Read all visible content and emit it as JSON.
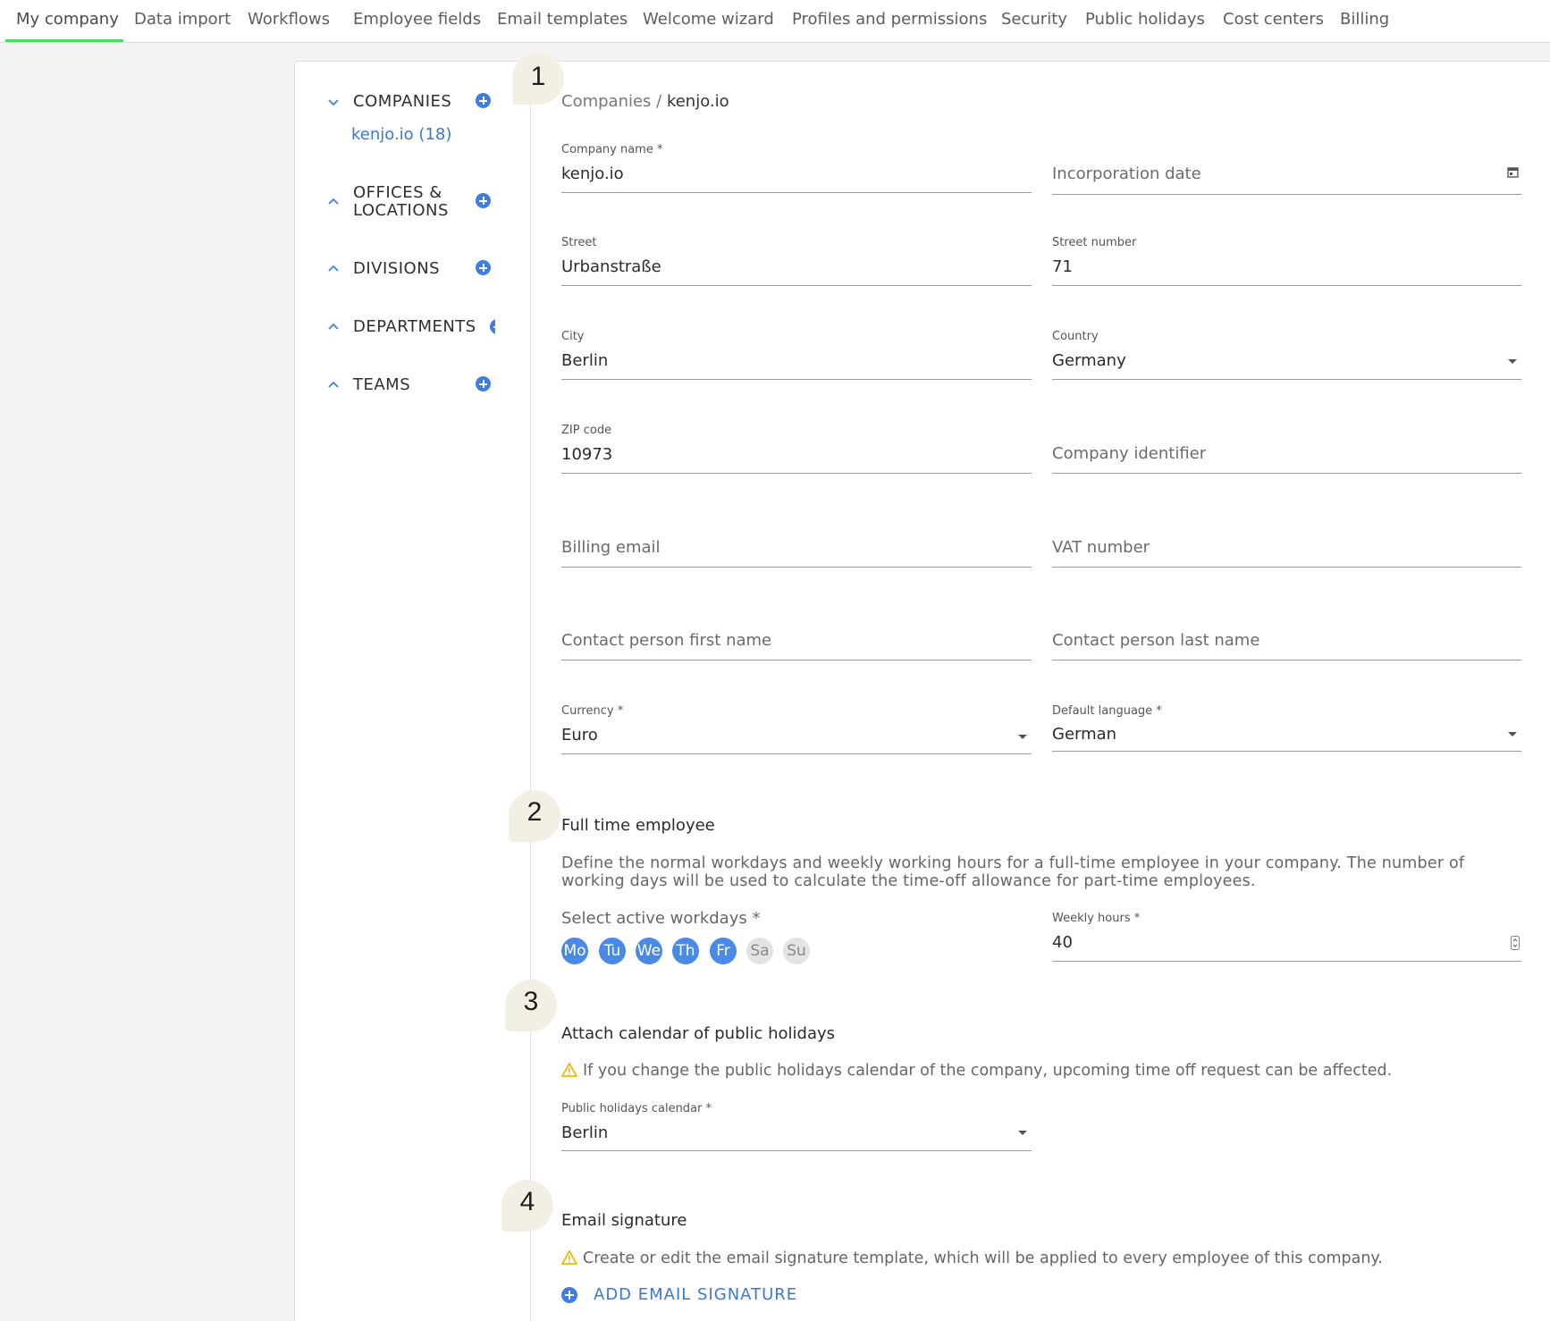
{
  "tabs": [
    "My company",
    "Data import",
    "Workflows",
    "Employee fields",
    "Email templates",
    "Welcome wizard",
    "Profiles and permissions",
    "Security",
    "Public holidays",
    "Cost centers",
    "Billing"
  ],
  "active_tab_color": "#4cd964",
  "accent_color": "#3f7ee0",
  "sidebar": {
    "sections": [
      {
        "label": "COMPANIES",
        "expanded": true
      },
      {
        "label": "OFFICES &",
        "label2": "LOCATIONS",
        "expanded": false
      },
      {
        "label": "DIVISIONS",
        "expanded": false
      },
      {
        "label": "DEPARTMENTS",
        "expanded": false
      },
      {
        "label": "TEAMS",
        "expanded": false
      }
    ],
    "companies": [
      "kenjo.io (18)"
    ]
  },
  "breadcrumb": {
    "root": "Companies",
    "sep": " / ",
    "current": "kenjo.io"
  },
  "steps": [
    "1",
    "2",
    "3",
    "4"
  ],
  "form": {
    "company_name": {
      "label": "Company name *",
      "value": "kenjo.io"
    },
    "incorporation_date": {
      "placeholder": "Incorporation date",
      "icon": "calendar-icon"
    },
    "street": {
      "label": "Street",
      "value": "Urbanstraße"
    },
    "street_number": {
      "label": "Street number",
      "value": "71"
    },
    "city": {
      "label": "City",
      "value": "Berlin"
    },
    "country": {
      "label": "Country",
      "value": "Germany"
    },
    "zip": {
      "label": "ZIP code",
      "value": "10973"
    },
    "company_identifier": {
      "placeholder": "Company identifier"
    },
    "billing_email": {
      "placeholder": "Billing email"
    },
    "vat_number": {
      "placeholder": "VAT number"
    },
    "contact_first": {
      "placeholder": "Contact person first name"
    },
    "contact_last": {
      "placeholder": "Contact person last name"
    },
    "currency": {
      "label": "Currency *",
      "value": "Euro"
    },
    "default_language": {
      "label": "Default language *",
      "value": "German"
    }
  },
  "fulltime": {
    "title": "Full time employee",
    "description": "Define the normal workdays and weekly working hours for a full-time employee in your company. The number of working days will be used to calculate the time-off allowance for part-time employees.",
    "workdays_label": "Select active workdays *",
    "days": [
      {
        "label": "Mo",
        "active": true
      },
      {
        "label": "Tu",
        "active": true
      },
      {
        "label": "We",
        "active": true
      },
      {
        "label": "Th",
        "active": true
      },
      {
        "label": "Fr",
        "active": true
      },
      {
        "label": "Sa",
        "active": false
      },
      {
        "label": "Su",
        "active": false
      }
    ],
    "weekly_hours": {
      "label": "Weekly hours *",
      "value": "40"
    }
  },
  "holidays": {
    "title": "Attach calendar of public holidays",
    "warning": "If you change the public holidays calendar of the company, upcoming time off request can be affected.",
    "calendar": {
      "label": "Public holidays calendar *",
      "value": "Berlin"
    }
  },
  "signature": {
    "title": "Email signature",
    "warning": "Create or edit the email signature template, which will be applied to every employee of this company.",
    "add_label": "ADD EMAIL SIGNATURE"
  }
}
